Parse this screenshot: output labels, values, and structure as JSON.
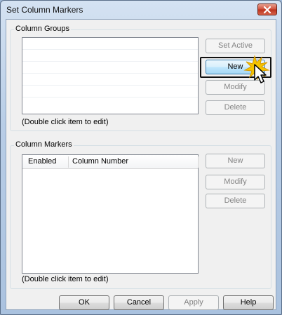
{
  "window": {
    "title": "Set Column Markers"
  },
  "column_groups": {
    "label": "Column Groups",
    "hint": "(Double click item to edit)",
    "buttons": {
      "set_active": "Set Active",
      "new": "New",
      "modify": "Modify",
      "delete": "Delete"
    }
  },
  "column_markers": {
    "label": "Column Markers",
    "hint": "(Double click item to edit)",
    "columns": [
      "Enabled",
      "Column Number"
    ],
    "buttons": {
      "new": "New",
      "modify": "Modify",
      "delete": "Delete"
    }
  },
  "footer": {
    "ok": "OK",
    "cancel": "Cancel",
    "apply": "Apply",
    "help": "Help"
  },
  "colors": {
    "highlight_border": "#111111",
    "click_burst": "#f5c400",
    "close_button": "#c9452f"
  },
  "icons": {
    "close": "close-icon",
    "cursor": "mouse-pointer-icon",
    "click": "click-burst-icon"
  }
}
